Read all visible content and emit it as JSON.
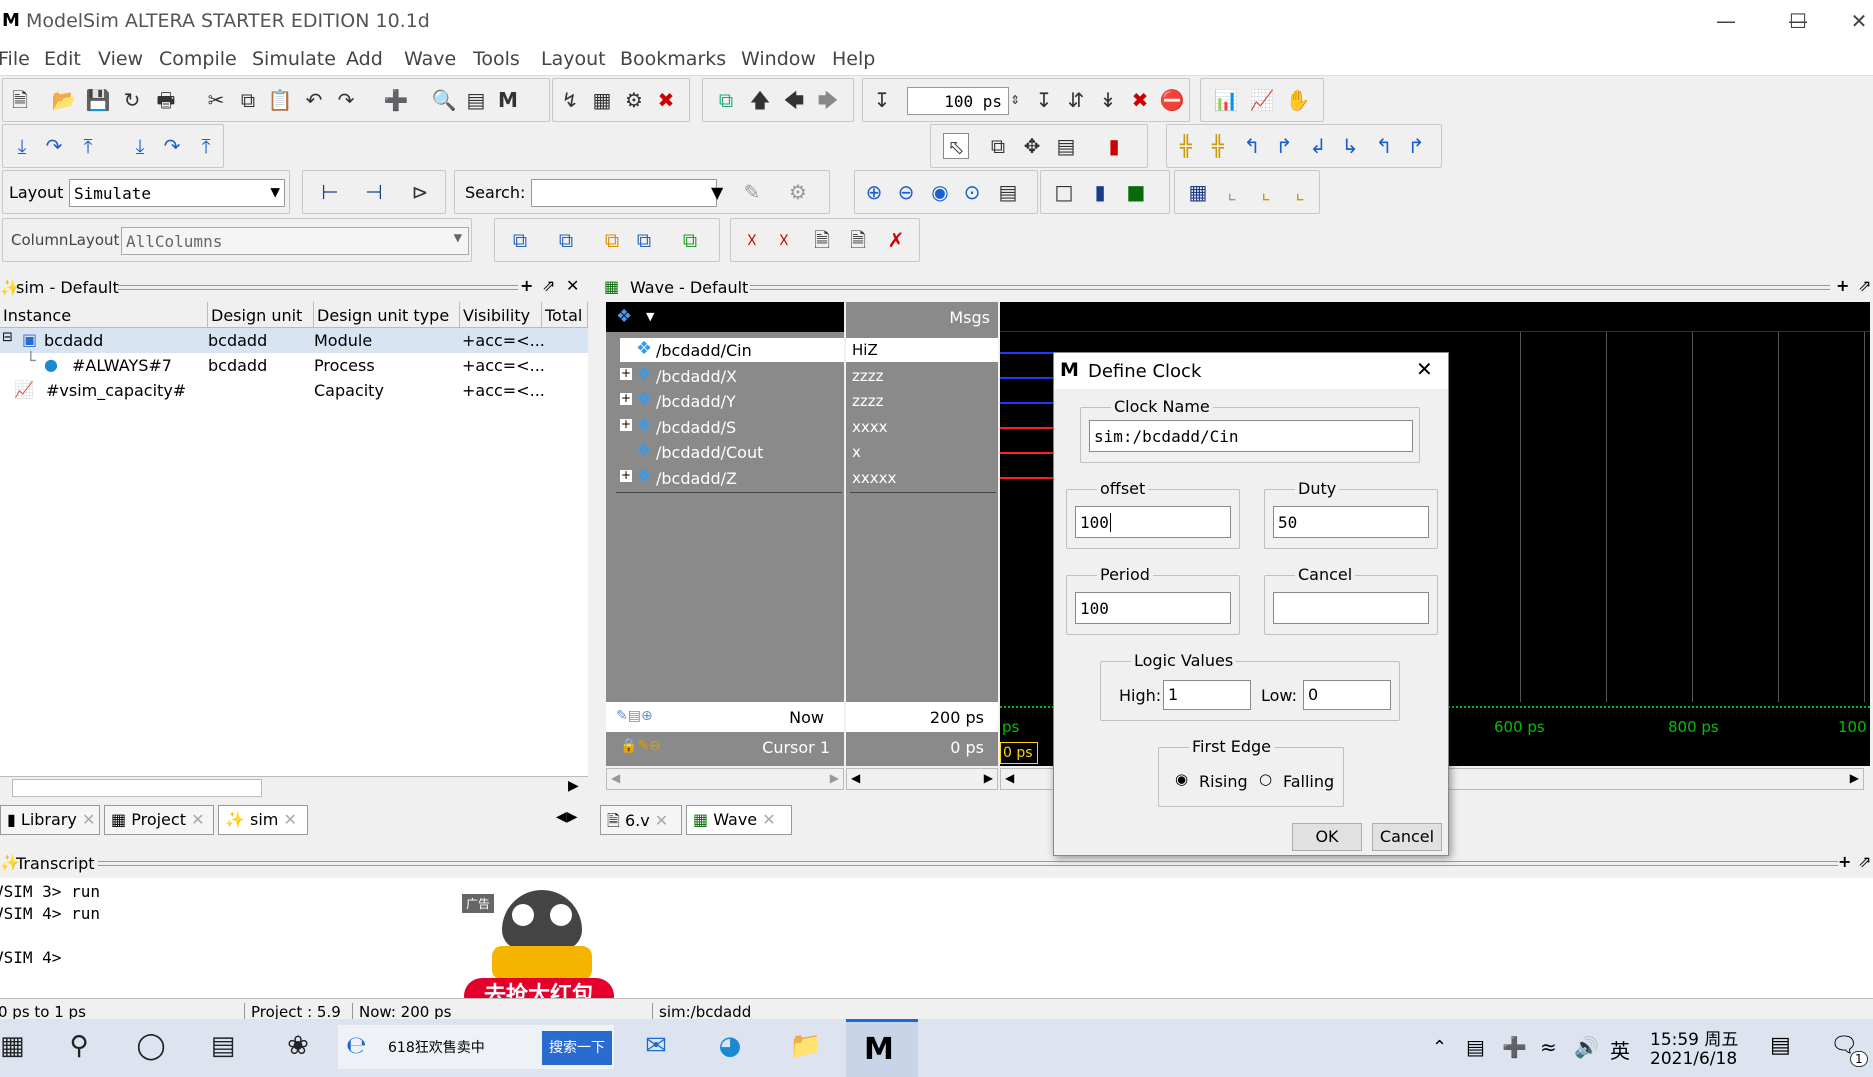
{
  "window": {
    "title": "ModelSim ALTERA STARTER EDITION 10.1d",
    "logo": "M"
  },
  "menu": [
    "File",
    "Edit",
    "View",
    "Compile",
    "Simulate",
    "Add",
    "Wave",
    "Tools",
    "Layout",
    "Bookmarks",
    "Window",
    "Help"
  ],
  "toolbar": {
    "time_value": "100 ps",
    "layout_label": "Layout",
    "layout_value": "Simulate",
    "search_label": "Search:",
    "search_value": "",
    "column_layout_label": "ColumnLayout",
    "column_layout_value": "AllColumns"
  },
  "sim_pane": {
    "title": "sim - Default",
    "columns": [
      "Instance",
      "Design unit",
      "Design unit type",
      "Visibility",
      "Total"
    ],
    "rows": [
      {
        "instance": "bcdadd",
        "design_unit": "bcdadd",
        "type": "Module",
        "visibility": "+acc=<...",
        "icon": "module-icon"
      },
      {
        "instance": "#ALWAYS#7",
        "design_unit": "bcdadd",
        "type": "Process",
        "visibility": "+acc=<...",
        "icon": "process-icon"
      },
      {
        "instance": "#vsim_capacity#",
        "design_unit": "",
        "type": "Capacity",
        "visibility": "+acc=<...",
        "icon": "capacity-icon"
      }
    ],
    "tabs": [
      "Library",
      "Project",
      "sim"
    ]
  },
  "wave_pane": {
    "title": "Wave - Default",
    "msgs_label": "Msgs",
    "signals": [
      {
        "name": "/bcdadd/Cin",
        "value": "HiZ"
      },
      {
        "name": "/bcdadd/X",
        "value": "zzzz"
      },
      {
        "name": "/bcdadd/Y",
        "value": "zzzz"
      },
      {
        "name": "/bcdadd/S",
        "value": "xxxx"
      },
      {
        "name": "/bcdadd/Cout",
        "value": "x"
      },
      {
        "name": "/bcdadd/Z",
        "value": "xxxxx"
      }
    ],
    "now_label": "Now",
    "now_value": "200 ps",
    "cursor_label": "Cursor 1",
    "cursor_value": "0 ps",
    "cursor_tag": "0 ps",
    "ruler": [
      "ps",
      "600 ps",
      "800 ps",
      "100"
    ],
    "tabs": [
      "6.v",
      "Wave"
    ]
  },
  "transcript": {
    "title": "Transcript",
    "lines": [
      "VSIM 3> run",
      "VSIM 4> run",
      "",
      "VSIM 4>"
    ]
  },
  "statusbar": {
    "range": "0 ps to 1 ps",
    "project": "Project : 5.9",
    "now": "Now: 200 ps",
    "context": "sim:/bcdadd"
  },
  "ad": {
    "badge": "广告",
    "text": "去抢大红包"
  },
  "dialog": {
    "title": "Define Clock",
    "clock_name_label": "Clock Name",
    "clock_name": "sim:/bcdadd/Cin",
    "offset_label": "offset",
    "offset": "100",
    "duty_label": "Duty",
    "duty": "50",
    "period_label": "Period",
    "period": "100",
    "cancel_label": "Cancel",
    "cancel_value": "",
    "logic_values_label": "Logic Values",
    "high_label": "High:",
    "high": "1",
    "low_label": "Low:",
    "low": "0",
    "first_edge_label": "First Edge",
    "rising": "Rising",
    "falling": "Falling",
    "ok": "OK",
    "cancel": "Cancel"
  },
  "taskbar": {
    "browser_tab": "618狂欢售卖中",
    "search_btn": "搜索一下",
    "ime": "英",
    "time": "15:59 周五",
    "date": "2021/6/18",
    "notif_count": "1"
  },
  "colors": {
    "wave_bg": "#000000",
    "signal_panel": "#8a8a8a",
    "blue_signal": "#1e3cff",
    "red_signal": "#ff2020",
    "ruler_green": "#00c000",
    "cursor_yellow": "#ffd800"
  }
}
